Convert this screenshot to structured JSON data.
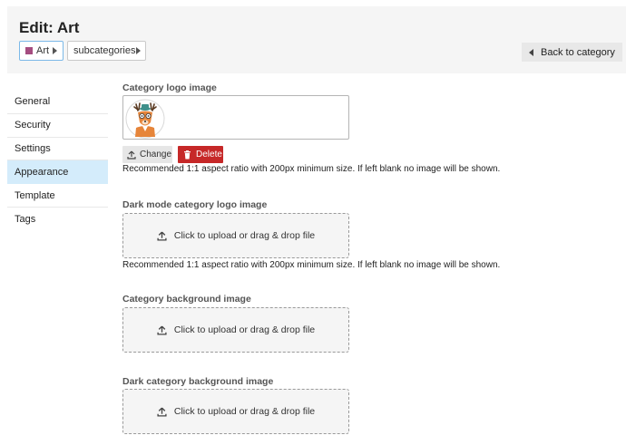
{
  "header": {
    "title": "Edit: Art",
    "breadcrumbs": [
      {
        "label": "Art",
        "color": "#a54d80"
      },
      {
        "label": "subcategories"
      }
    ],
    "back_label": "Back to category"
  },
  "nav": {
    "items": [
      {
        "label": "General",
        "active": false
      },
      {
        "label": "Security",
        "active": false
      },
      {
        "label": "Settings",
        "active": false
      },
      {
        "label": "Appearance",
        "active": true
      },
      {
        "label": "Template",
        "active": false
      },
      {
        "label": "Tags",
        "active": false
      }
    ]
  },
  "appearance": {
    "logo": {
      "label": "Category logo image",
      "image_icon": "deer-mascot-image",
      "change_label": "Change",
      "delete_label": "Delete",
      "help": "Recommended 1:1 aspect ratio with 200px minimum size. If left blank no image will be shown."
    },
    "dark_logo": {
      "label": "Dark mode category logo image",
      "upload_text": "Click to upload or drag & drop file",
      "help": "Recommended 1:1 aspect ratio with 200px minimum size. If left blank no image will be shown."
    },
    "background": {
      "label": "Category background image",
      "upload_text": "Click to upload or drag & drop file"
    },
    "dark_background": {
      "label": "Dark category background image",
      "upload_text": "Click to upload or drag & drop file"
    }
  },
  "colors": {
    "accent": "#d4ecfb",
    "delete": "#c62828",
    "category": "#a54d80"
  }
}
